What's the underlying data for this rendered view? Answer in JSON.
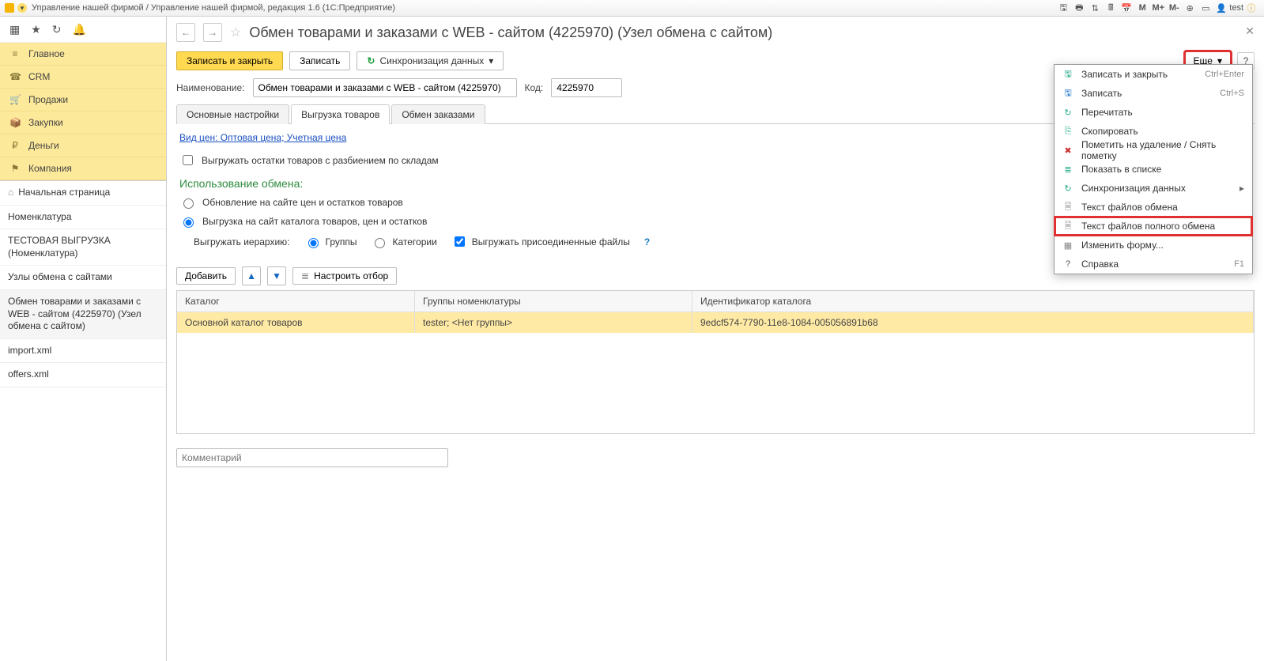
{
  "titlebar": {
    "title": "Управление нашей фирмой / Управление нашей фирмой, редакция 1.6  (1С:Предприятие)",
    "user": "test",
    "icons": {
      "m": "M",
      "mplus": "M+",
      "mminus": "M-"
    }
  },
  "sidebar": {
    "sections": [
      {
        "icon": "≡",
        "label": "Главное"
      },
      {
        "icon": "☎",
        "label": "CRM"
      },
      {
        "icon": "🛒",
        "label": "Продажи"
      },
      {
        "icon": "📦",
        "label": "Закупки"
      },
      {
        "icon": "₽",
        "label": "Деньги"
      },
      {
        "icon": "⚑",
        "label": "Компания"
      }
    ],
    "nav": [
      {
        "icon": "⌂",
        "label": "Начальная страница"
      },
      {
        "label": "Номенклатура"
      },
      {
        "label": "ТЕСТОВАЯ ВЫГРУЗКА (Номенклатура)"
      },
      {
        "label": "Узлы обмена с сайтами"
      },
      {
        "label": "Обмен товарами и заказами с WEB - сайтом (4225970) (Узел обмена с сайтом)",
        "active": true
      },
      {
        "label": "import.xml"
      },
      {
        "label": "offers.xml"
      }
    ]
  },
  "page": {
    "title": "Обмен товарами и заказами с WEB - сайтом (4225970) (Узел обмена с сайтом)",
    "cmd": {
      "save_close": "Записать и закрыть",
      "save": "Записать",
      "sync": "Синхронизация данных",
      "more": "Еще",
      "help": "?"
    },
    "fields": {
      "name_label": "Наименование:",
      "name_value": "Обмен товарами и заказами с WEB - сайтом (4225970)",
      "code_label": "Код:",
      "code_value": "4225970"
    },
    "tabs": [
      "Основные настройки",
      "Выгрузка товаров",
      "Обмен заказами"
    ],
    "active_tab": 1,
    "price_link": "Вид цен: Оптовая цена; Учетная цена",
    "chk_warehouse": "Выгружать остатки товаров с разбиением по складам",
    "section": "Использование обмена:",
    "r1": "Обновление на сайте цен и остатков товаров",
    "r2": "Выгрузка на сайт каталога товаров, цен и остатков",
    "sub": {
      "label": "Выгружать иерархию:",
      "opt1": "Группы",
      "opt2": "Категории",
      "chk": "Выгружать присоединенные файлы"
    },
    "tblcmd": {
      "add": "Добавить",
      "filter": "Настроить отбор"
    },
    "grid": {
      "headers": [
        "Каталог",
        "Группы номенклатуры",
        "Идентификатор каталога"
      ],
      "row": [
        "Основной каталог товаров",
        "tester; <Нет группы>",
        "9edcf574-7790-11e8-1084-005056891b68"
      ]
    },
    "comment_placeholder": "Комментарий"
  },
  "menu": {
    "items": [
      {
        "icon": "🖫",
        "c": "#2a8",
        "label": "Записать и закрыть",
        "sc": "Ctrl+Enter"
      },
      {
        "icon": "🖫",
        "c": "#27c",
        "label": "Записать",
        "sc": "Ctrl+S"
      },
      {
        "icon": "↻",
        "c": "#2a8",
        "label": "Перечитать"
      },
      {
        "icon": "⎘",
        "c": "#2a8",
        "label": "Скопировать"
      },
      {
        "icon": "✖",
        "c": "#c33",
        "label": "Пометить на удаление / Снять пометку"
      },
      {
        "icon": "≣",
        "c": "#2a8",
        "label": "Показать в списке"
      },
      {
        "icon": "↻",
        "c": "#2a8",
        "label": "Синхронизация данных",
        "sub": true
      },
      {
        "icon": "🗎",
        "c": "#888",
        "label": "Текст файлов обмена"
      },
      {
        "icon": "🗎",
        "c": "#888",
        "label": "Текст файлов полного обмена",
        "hl": true
      },
      {
        "icon": "▦",
        "c": "#888",
        "label": "Изменить форму..."
      },
      {
        "icon": "?",
        "c": "#555",
        "label": "Справка",
        "sc": "F1"
      }
    ]
  }
}
